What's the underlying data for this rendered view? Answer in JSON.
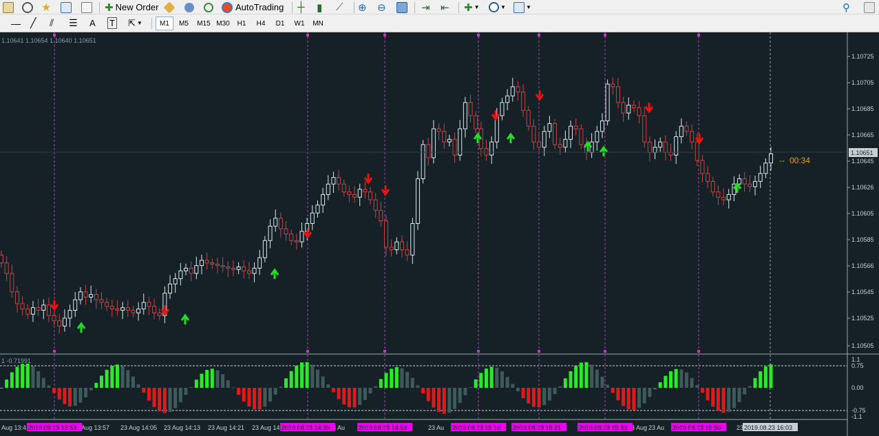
{
  "toolbar": {
    "new_order_label": "New Order",
    "autotrading_label": "AutoTrading",
    "icons_left": [
      "new-chart-icon",
      "profiles-icon",
      "favorites-icon",
      "market-watch-icon",
      "data-window-icon"
    ],
    "icons_mid": [
      "metaeditor-icon",
      "signals-icon"
    ],
    "icons_right": [
      "bar-chart-icon",
      "candlestick-icon",
      "line-chart-icon",
      "zoom-in-icon",
      "zoom-out-icon",
      "tile-windows-icon",
      "chart-shift-icon",
      "autoscroll-icon",
      "indicators-icon",
      "periods-icon",
      "templates-icon"
    ],
    "search_icon": "search-icon"
  },
  "drawing_toolbar": {
    "tools": [
      "cursor-line-icon",
      "trendline-icon",
      "equidistant-channel-icon",
      "fibonacci-icon",
      "text-icon",
      "text-label-icon",
      "arrows-icon"
    ],
    "text_tool": "A",
    "timeframes": [
      "M1",
      "M5",
      "M15",
      "M30",
      "H1",
      "H4",
      "D1",
      "W1",
      "MN"
    ],
    "active_timeframe": "M1"
  },
  "chart": {
    "ohlc_header": "1.10641 1.10654 1.10640 1.10651",
    "price_labels": [
      "1.10725",
      "1.10705",
      "1.10685",
      "1.10665",
      "1.10645",
      "1.10626",
      "1.10605",
      "1.10585",
      "1.10566",
      "1.10545",
      "1.10525",
      "1.10505"
    ],
    "current_price": "1.10651",
    "countdown": "00:34",
    "indicator_header": "1 -0.71991",
    "indicator_labels": [
      "1.1",
      "0.75",
      "0.00",
      "-0.75",
      "-1.1"
    ],
    "time_labels": [
      "Aug 13:41",
      "Aug 13:57",
      "23 Aug 14:05",
      "23 Aug 14:13",
      "23 Aug 14:21",
      "23 Aug 14:",
      "23 Au",
      "23 Aug",
      "23 Au",
      "23 Au",
      "23 Aug",
      "23 Au",
      "23"
    ],
    "highlighted_times": [
      "2019.08.23 13:53",
      "2019.08.23 14:39",
      "2019.08.23 14:53",
      "2019.08.23 15:10",
      "2019.08.23 15:21",
      "2019.08.23 15:33",
      "2019.08.23 15:50",
      "2019.08.23 16:03"
    ],
    "colors": {
      "background": "#152127",
      "bull": "#d8ecf0",
      "bear": "#c74545",
      "up_arrow": "#22dd22",
      "down_arrow": "#ee1111",
      "hist_green": "#2ee82e",
      "hist_red": "#e01a1a",
      "hist_gray": "#3e5a5a",
      "vline": "#cc33cc",
      "time_highlight": "#ee00ee"
    }
  }
}
